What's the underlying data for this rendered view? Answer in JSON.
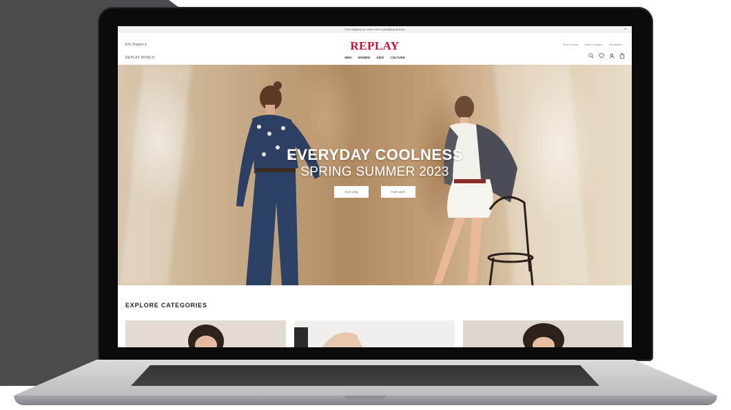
{
  "announcement": {
    "text": "Free shipping on orders over a qualifying amount",
    "close": "×"
  },
  "header": {
    "language": "EN | Region ▾",
    "world": "REPLAY WORLD",
    "logo": "REPLAY",
    "nav": [
      "MEN",
      "WOMEN",
      "KIDS",
      "CULTURE"
    ],
    "utility": [
      "Store locator",
      "Help & support",
      "Newsletter"
    ],
    "icons": [
      "search-icon",
      "heart-icon",
      "user-icon",
      "bag-icon"
    ]
  },
  "hero": {
    "title": "EVERYDAY COOLNESS",
    "subtitle": "SPRING SUMMER 2023",
    "buttons": [
      "FOR HIM",
      "FOR HER"
    ]
  },
  "explore": {
    "title": "EXPLORE CATEGORIES"
  },
  "colors": {
    "brand": "#c8102e",
    "background_panel": "#4a4b4f",
    "laptop_bezel": "#0b0b0c"
  }
}
